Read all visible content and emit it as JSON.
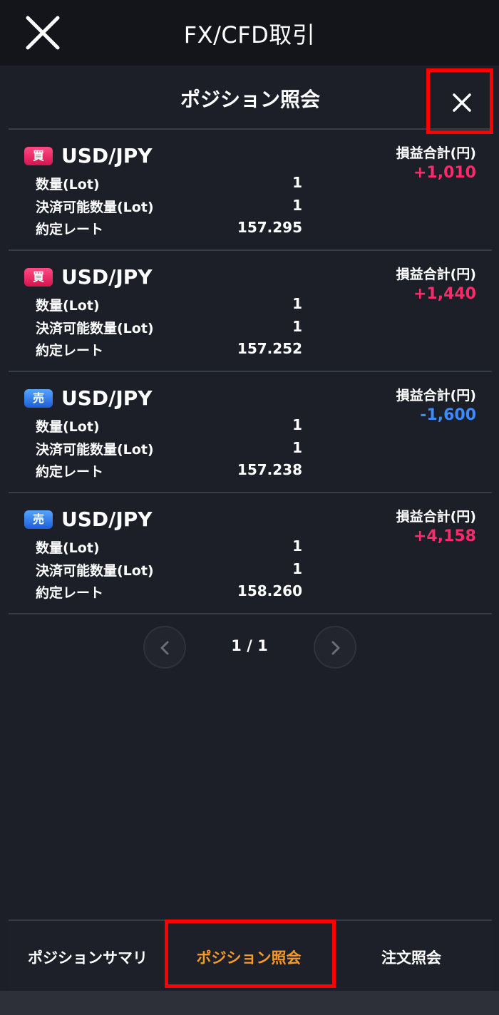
{
  "header": {
    "title": "FX/CFD取引"
  },
  "panel": {
    "title": "ポジション照会"
  },
  "labels": {
    "quantity": "数量(Lot)",
    "settleable": "決済可能数量(Lot)",
    "rate": "約定レート",
    "pnl": "損益合計(円)"
  },
  "positions": [
    {
      "side": "買",
      "side_type": "buy",
      "pair": "USD/JPY",
      "quantity": "1",
      "settleable": "1",
      "rate": "157.295",
      "pnl": "+1,010",
      "pnl_color": "#ff2a6a"
    },
    {
      "side": "買",
      "side_type": "buy",
      "pair": "USD/JPY",
      "quantity": "1",
      "settleable": "1",
      "rate": "157.252",
      "pnl": "+1,440",
      "pnl_color": "#ff2a6a"
    },
    {
      "side": "売",
      "side_type": "sell",
      "pair": "USD/JPY",
      "quantity": "1",
      "settleable": "1",
      "rate": "157.238",
      "pnl": "-1,600",
      "pnl_color": "#3d8bff"
    },
    {
      "side": "売",
      "side_type": "sell",
      "pair": "USD/JPY",
      "quantity": "1",
      "settleable": "1",
      "rate": "158.260",
      "pnl": "+4,158",
      "pnl_color": "#ff2a6a"
    }
  ],
  "pager": {
    "text": "1 / 1"
  },
  "tabs": {
    "summary": "ポジションサマリ",
    "positions": "ポジション照会",
    "orders": "注文照会"
  },
  "colors": {
    "active_tab": "#f39a2b",
    "highlight": "#ff0000"
  }
}
